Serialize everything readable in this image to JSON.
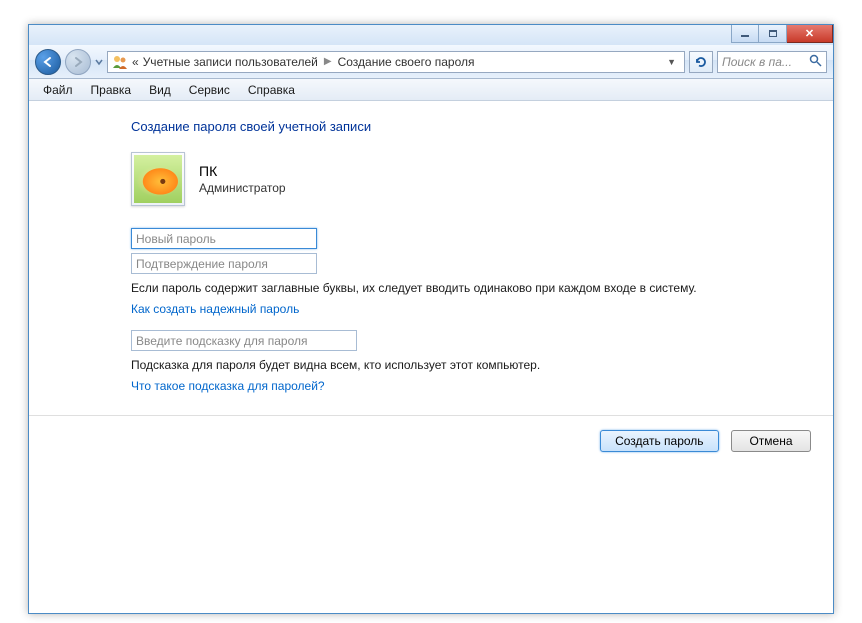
{
  "window": {
    "minimize": "_",
    "maximize": "□",
    "close": "✕"
  },
  "breadcrumb": {
    "prefix": "«",
    "level1": "Учетные записи пользователей",
    "level2": "Создание своего пароля"
  },
  "search": {
    "placeholder": "Поиск в па..."
  },
  "menu": {
    "file": "Файл",
    "edit": "Правка",
    "view": "Вид",
    "tools": "Сервис",
    "help": "Справка"
  },
  "page": {
    "title": "Создание пароля своей учетной записи",
    "account_name": "ПК",
    "account_role": "Администратор",
    "new_password_placeholder": "Новый пароль",
    "confirm_password_placeholder": "Подтверждение пароля",
    "caps_note": "Если пароль содержит заглавные буквы, их следует вводить одинаково при каждом входе в систему.",
    "strong_password_link": "Как создать надежный пароль",
    "hint_placeholder": "Введите подсказку для пароля",
    "hint_note": "Подсказка для пароля будет видна всем, кто использует этот компьютер.",
    "hint_link": "Что такое подсказка для паролей?"
  },
  "buttons": {
    "create": "Создать пароль",
    "cancel": "Отмена"
  }
}
